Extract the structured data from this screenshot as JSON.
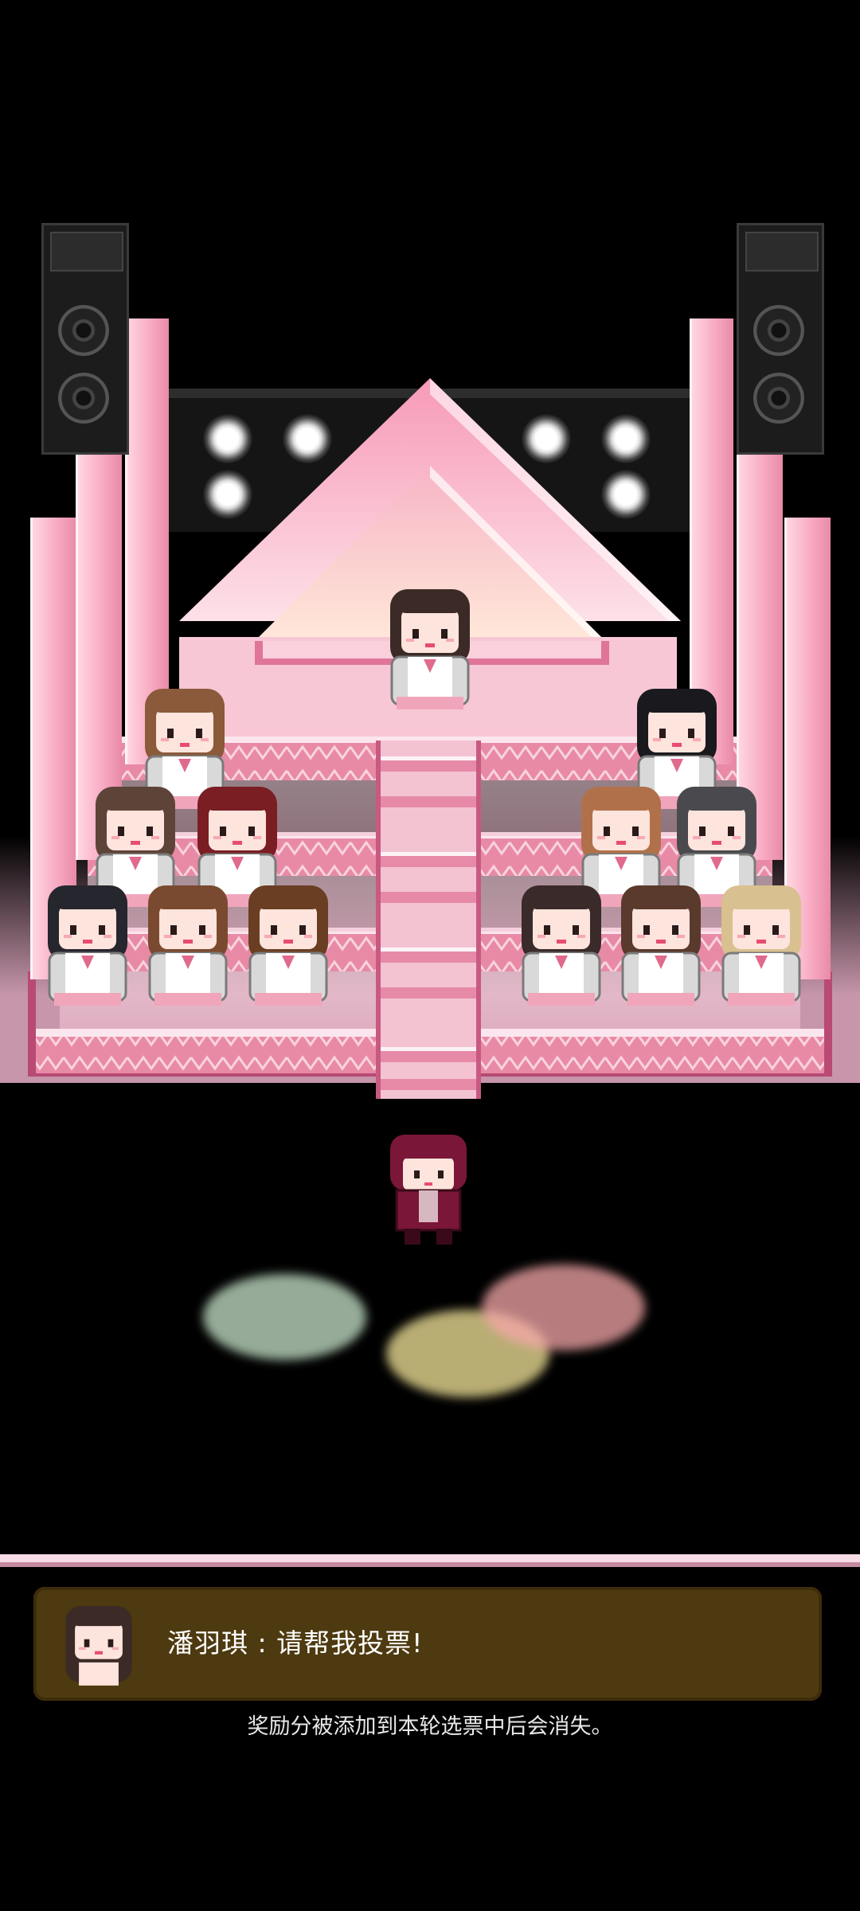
{
  "dialog": {
    "speaker": "潘羽琪",
    "separator": " : ",
    "message": "请帮我投票!"
  },
  "hint": "奖励分被添加到本轮选票中后会消失。",
  "colors": {
    "background": "#000000",
    "stage_pink": "#f7a7c0",
    "floor": "#f0d2dc",
    "dialog_bg": "#4e3a10",
    "text": "#ffffff"
  },
  "icons": [
    "speaker-left-icon",
    "speaker-right-icon",
    "stage-light-icon",
    "pyramid-stage",
    "idol-character",
    "player-character",
    "speaker-portrait"
  ]
}
